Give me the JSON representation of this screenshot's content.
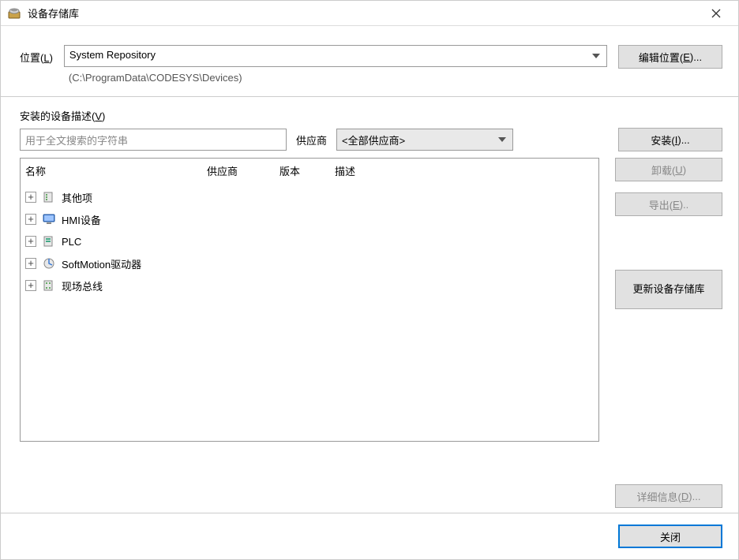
{
  "title": "设备存储库",
  "location": {
    "label_pre": "位置(",
    "label_u": "L",
    "label_post": ")",
    "selected": "System Repository",
    "path": "(C:\\ProgramData\\CODESYS\\Devices)",
    "edit_button_pre": "编辑位置(",
    "edit_button_u": "E",
    "edit_button_post": ")..."
  },
  "installed": {
    "label_pre": "安装的设备描述(",
    "label_u": "V",
    "label_post": ")",
    "search_placeholder": "用于全文搜索的字符串",
    "supplier_label": "供应商",
    "supplier_selected": "<全部供应商>"
  },
  "columns": {
    "name": "名称",
    "vendor": "供应商",
    "version": "版本",
    "desc": "描述"
  },
  "tree": [
    {
      "label": "其他项",
      "icon": "folder"
    },
    {
      "label": "HMI设备",
      "icon": "monitor"
    },
    {
      "label": "PLC",
      "icon": "plc"
    },
    {
      "label": "SoftMotion驱动器",
      "icon": "motion"
    },
    {
      "label": "现场总线",
      "icon": "bus"
    }
  ],
  "buttons": {
    "install_pre": "安装(",
    "install_u": "I",
    "install_post": ")...",
    "uninstall_pre": "卸载(",
    "uninstall_u": "U",
    "uninstall_post": ")",
    "export_pre": "导出(",
    "export_u": "E",
    "export_post": ")..",
    "update": "更新设备存储库",
    "details_pre": "详细信息(",
    "details_u": "D",
    "details_post": ")...",
    "close": "关闭"
  }
}
